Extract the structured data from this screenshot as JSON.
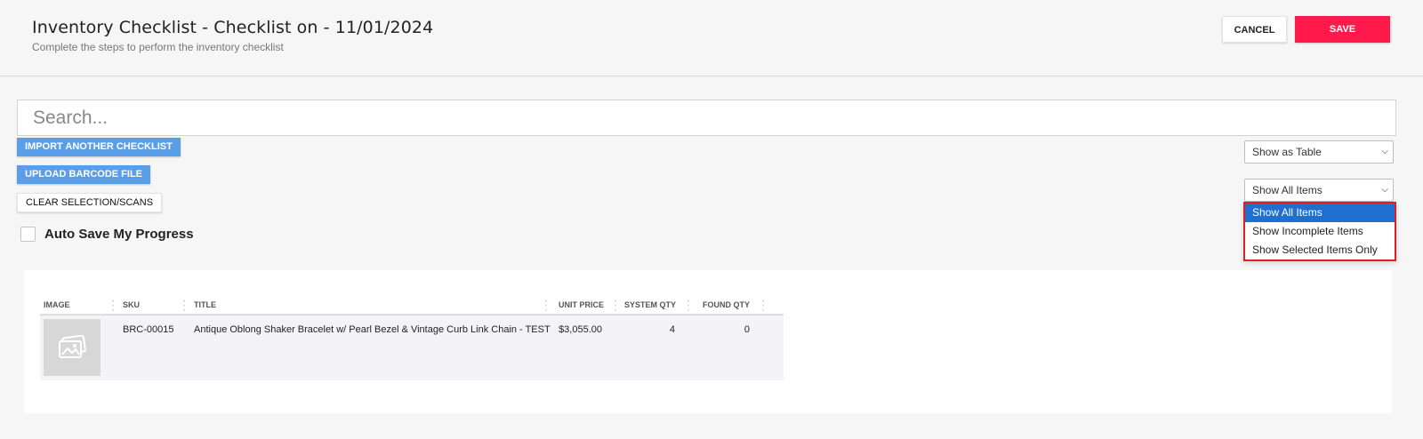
{
  "header": {
    "title": "Inventory Checklist - Checklist on - 11/01/2024",
    "subtitle": "Complete the steps to perform the inventory checklist",
    "cancel_label": "CANCEL",
    "save_label": "SAVE"
  },
  "search": {
    "placeholder": "Search...",
    "value": ""
  },
  "actions": {
    "import_label": "IMPORT ANOTHER CHECKLIST",
    "upload_label": "UPLOAD BARCODE FILE",
    "clear_label": "CLEAR SELECTION/SCANS"
  },
  "auto_save": {
    "label": "Auto Save My Progress",
    "checked": false
  },
  "view_select": {
    "value": "Show as Table"
  },
  "filter_select": {
    "value": "Show All Items",
    "options": [
      "Show All Items",
      "Show Incomplete Items",
      "Show Selected Items Only"
    ],
    "selected_index": 0
  },
  "table": {
    "columns": [
      "IMAGE",
      "SKU",
      "TITLE",
      "UNIT PRICE",
      "SYSTEM QTY",
      "FOUND QTY"
    ],
    "rows": [
      {
        "image": "image-placeholder-icon",
        "sku": "BRC-00015",
        "title": "Antique Oblong Shaker Bracelet w/ Pearl Bezel & Vintage Curb Link Chain - TEST",
        "unit_price": "$3,055.00",
        "system_qty": "4",
        "found_qty": "0"
      }
    ]
  },
  "colors": {
    "save": "#ff1a4b",
    "action_blue": "#5b9ee8",
    "option_selected": "#1f6fd1",
    "dropdown_highlight_border": "#e02020"
  }
}
